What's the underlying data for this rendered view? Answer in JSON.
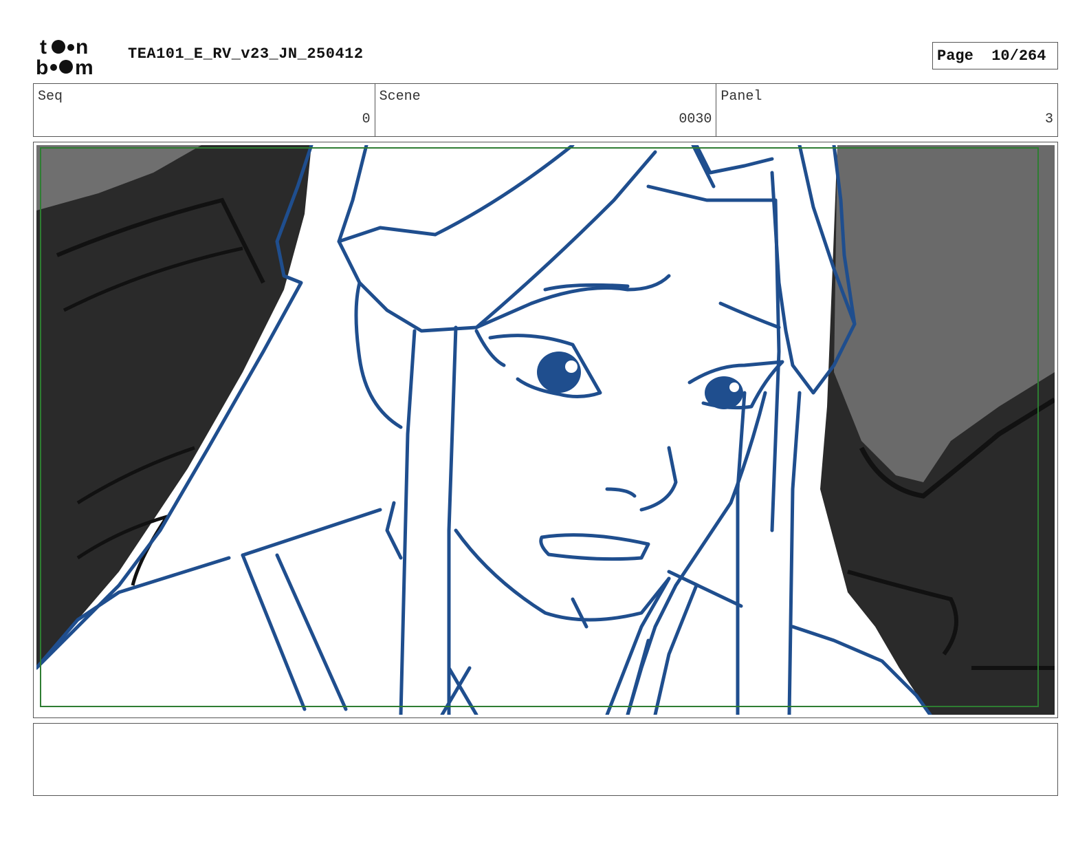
{
  "header": {
    "logo_text": "toonboom",
    "document_title": "TEA101_E_RV_v23_JN_250412",
    "page_label": "Page",
    "page_value": "10/264"
  },
  "info": {
    "seq_label": "Seq",
    "seq_value": "0",
    "scene_label": "Scene",
    "scene_value": "0030",
    "panel_label": "Panel",
    "panel_value": "3"
  },
  "panel": {
    "image": "storyboard-drawing",
    "line_color": "#1f4e8e",
    "background_dark": "#2a2a2a",
    "background_mid": "#6a6a6a",
    "safe_frame_color": "#2e7d32"
  },
  "notes": {
    "text": ""
  }
}
